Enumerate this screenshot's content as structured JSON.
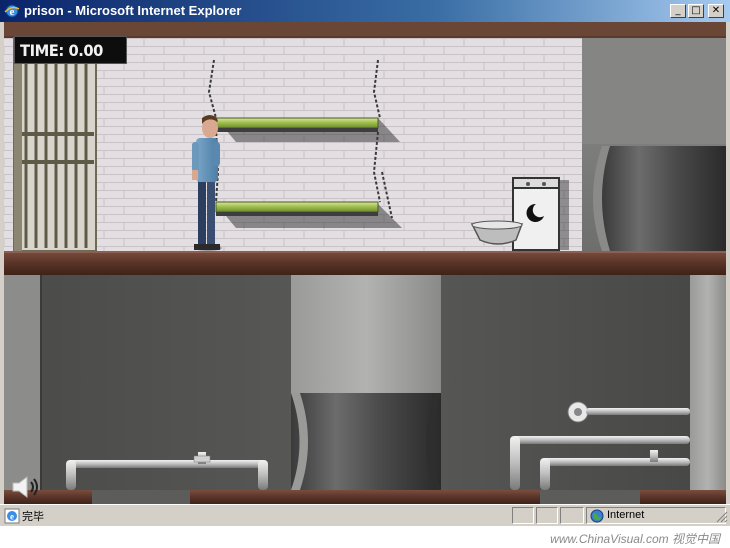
{
  "window": {
    "title": "prison - Microsoft Internet Explorer",
    "minimize_glyph": "_",
    "maximize_glyph": "□",
    "close_glyph": "✕"
  },
  "game": {
    "timer_text": "TIME: 0.00",
    "icons": {
      "speaker": "speaker-icon"
    }
  },
  "statusbar": {
    "status_text": "完毕",
    "zone_text": "Internet"
  },
  "watermark": {
    "text": "www.ChinaVisual.com 视觉中国"
  }
}
